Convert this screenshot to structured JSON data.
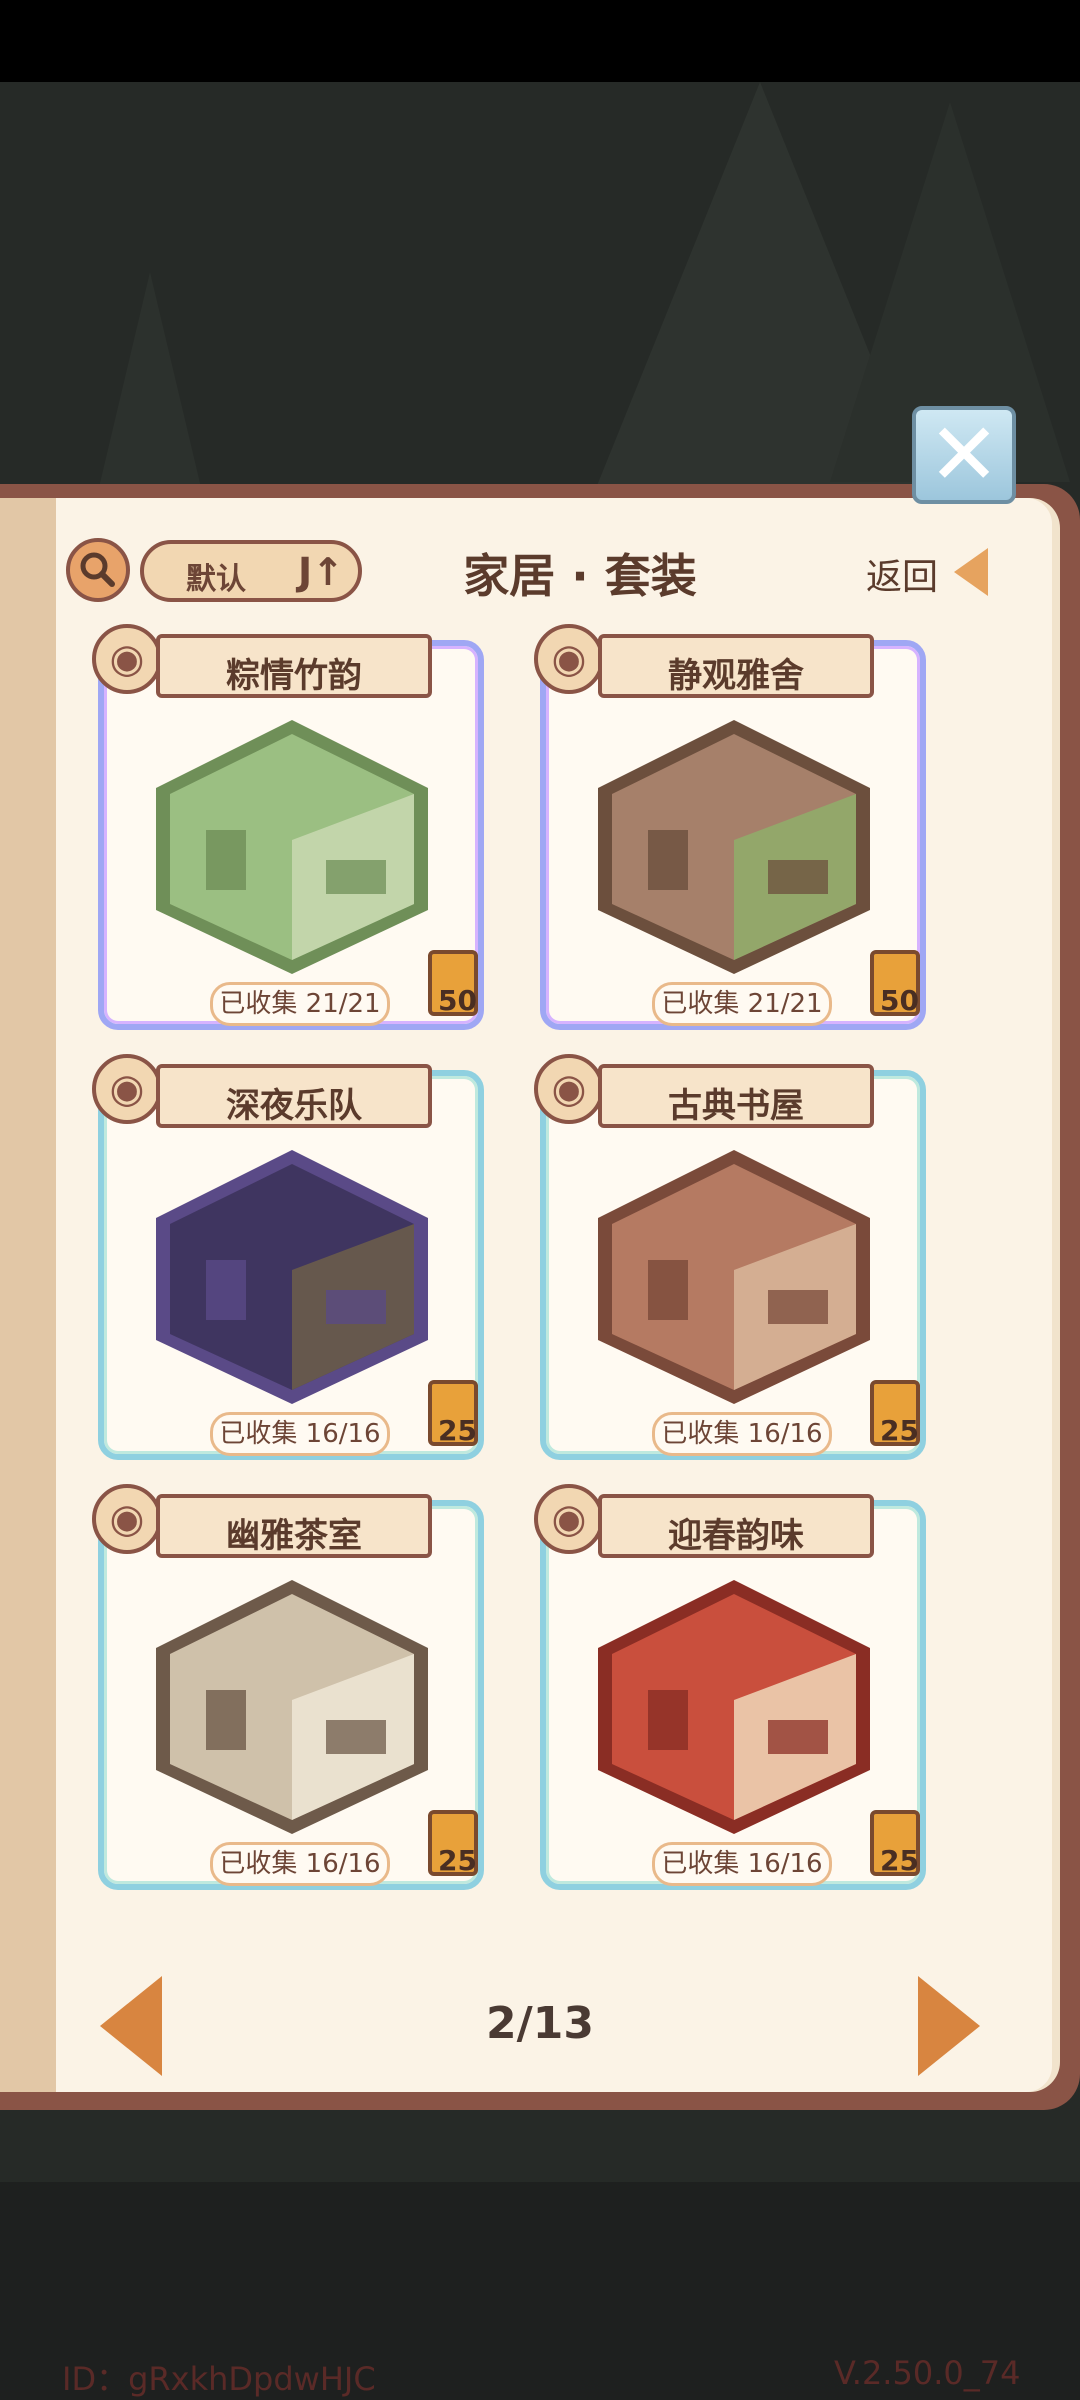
{
  "header": {
    "sort_label": "默认",
    "sort_icon": "J↑",
    "title": "家居 · 套装",
    "back_label": "返回"
  },
  "cards": [
    {
      "name": "粽情竹韵",
      "collected": "已收集 21/21",
      "reward": "50",
      "frame": "purple",
      "palette": [
        "#9bbf82",
        "#6f8f58",
        "#c9d8b2"
      ]
    },
    {
      "name": "静观雅舍",
      "collected": "已收集 21/21",
      "reward": "50",
      "frame": "purple",
      "palette": [
        "#a6806a",
        "#6c4f3d",
        "#8fae6a"
      ]
    },
    {
      "name": "深夜乐队",
      "collected": "已收集 16/16",
      "reward": "25",
      "frame": "teal",
      "palette": [
        "#3f3560",
        "#5a4a87",
        "#6d5e4a"
      ]
    },
    {
      "name": "古典书屋",
      "collected": "已收集 16/16",
      "reward": "25",
      "frame": "teal",
      "palette": [
        "#b57a62",
        "#7a4a3a",
        "#d9b79b"
      ]
    },
    {
      "name": "幽雅茶室",
      "collected": "已收集 16/16",
      "reward": "25",
      "frame": "teal",
      "palette": [
        "#cfc1aa",
        "#6e5a4a",
        "#efe6d6"
      ]
    },
    {
      "name": "迎春韵味",
      "collected": "已收集 16/16",
      "reward": "25",
      "frame": "teal",
      "palette": [
        "#c94f3d",
        "#8a2d24",
        "#f0d7b9"
      ]
    }
  ],
  "pagination": {
    "label": "2/13"
  },
  "footer": {
    "id": "ID：gRxkhDpdwHJC",
    "version": "V.2.50.0_74"
  },
  "icons": {
    "close": "close-icon",
    "search": "search-icon",
    "eye": "eye-icon",
    "book": "book-icon"
  },
  "colors": {
    "accent": "#d88540",
    "frame_purple": "#9fa7f4",
    "frame_teal": "#8fd0e0"
  }
}
